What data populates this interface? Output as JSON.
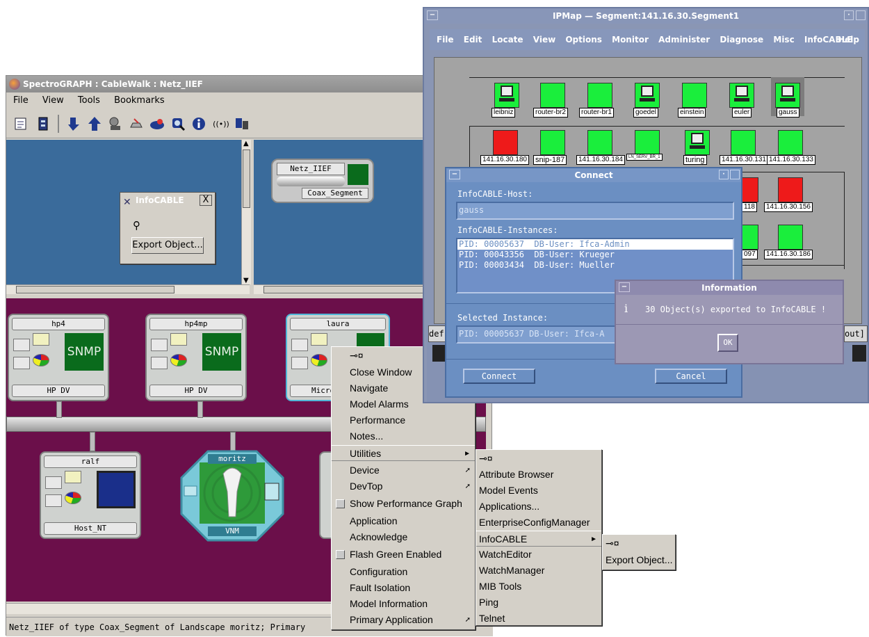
{
  "spectrograph": {
    "title": "SpectroGRAPH : CableWalk : Netz_IIEF",
    "menu": [
      "File",
      "View",
      "Tools",
      "Bookmarks"
    ],
    "toolbar_icons": [
      "notepad-icon",
      "archive-icon",
      "navigate-down-icon",
      "navigate-up-icon",
      "locate-icon",
      "alarm-icon",
      "network-icon",
      "search-icon",
      "info-icon",
      "broadcast-icon",
      "tools-icon"
    ],
    "infocable_window": {
      "title": "InfoCABLE",
      "close": "X",
      "export_button": "Export Object..."
    },
    "netz_object": {
      "name": "Netz_IIEF",
      "type": "Coax_Segment"
    },
    "devices": [
      {
        "name": "hp4",
        "type": "HP DV",
        "badge": "SNMP"
      },
      {
        "name": "hp4mp",
        "type": "HP DV",
        "badge": "SNMP"
      },
      {
        "name": "laura",
        "type": "Micro"
      },
      {
        "name": "ralf",
        "type": "Host_NT"
      },
      {
        "name": "moritz",
        "type": "VNM"
      }
    ],
    "status_text": "Netz_IIEF of type Coax_Segment of Landscape moritz; Primary"
  },
  "context_menu": {
    "items": [
      {
        "label": "Close Window"
      },
      {
        "label": "Navigate"
      },
      {
        "label": "Model Alarms"
      },
      {
        "label": "Performance"
      },
      {
        "label": "Notes..."
      },
      {
        "label": "Utilities",
        "submenu": true,
        "selected": true
      },
      {
        "label": "Device",
        "submenu": true
      },
      {
        "label": "DevTop",
        "submenu": true
      },
      {
        "label": "Show Performance Graph",
        "check": true
      },
      {
        "label": "Application"
      },
      {
        "label": "Acknowledge"
      },
      {
        "label": "Flash Green Enabled",
        "check": true
      },
      {
        "label": "Configuration"
      },
      {
        "label": "Fault Isolation"
      },
      {
        "label": "Model Information"
      },
      {
        "label": "Primary Application",
        "submenu": true
      }
    ]
  },
  "utilities_menu": {
    "items": [
      {
        "label": "Attribute Browser"
      },
      {
        "label": "Model Events"
      },
      {
        "label": "Applications..."
      },
      {
        "label": "EnterpriseConfigManager"
      },
      {
        "label": "InfoCABLE",
        "submenu": true,
        "selected": true
      },
      {
        "label": "WatchEditor"
      },
      {
        "label": "WatchManager"
      },
      {
        "label": "MIB Tools"
      },
      {
        "label": "Ping"
      },
      {
        "label": "Telnet"
      }
    ]
  },
  "infocable_menu": {
    "items": [
      {
        "label": "Export Object..."
      }
    ]
  },
  "ipmap": {
    "title": "IPMap — Segment:141.16.30.Segment1",
    "menu": [
      "File",
      "Edit",
      "Locate",
      "View",
      "Options",
      "Monitor",
      "Administer",
      "Diagnose",
      "Misc",
      "InfoCABLE",
      "Help"
    ],
    "row1": [
      {
        "label": "leibniz",
        "status": "green",
        "terminal": true
      },
      {
        "label": "router-br2",
        "status": "green"
      },
      {
        "label": "router-br1",
        "status": "green"
      },
      {
        "label": "goedel",
        "status": "green",
        "terminal": true
      },
      {
        "label": "einstein",
        "status": "green"
      },
      {
        "label": "euler",
        "status": "green",
        "terminal": true
      },
      {
        "label": "gauss",
        "status": "green",
        "terminal": true
      }
    ],
    "row2": [
      {
        "label": "141.16.30.180",
        "status": "red"
      },
      {
        "label": "snip-187",
        "status": "green"
      },
      {
        "label": "141.16.30.184",
        "status": "green"
      },
      {
        "label": "LN_SERV_BR_1",
        "status": "green"
      },
      {
        "label": "turing",
        "status": "terminal"
      },
      {
        "label": "141.16.30.131",
        "status": "green"
      },
      {
        "label": "141.16.30.133",
        "status": "green"
      }
    ],
    "row3": [
      {
        "label": "118",
        "status": "red"
      },
      {
        "label": "141.16.30.156",
        "status": "red"
      }
    ],
    "row4": [
      {
        "label": "097",
        "status": "green"
      },
      {
        "label": "141.16.30.186",
        "status": "green"
      }
    ],
    "bottom_left": "def",
    "bottom_right": "out]"
  },
  "connect_dialog": {
    "title": "Connect",
    "host_label": "InfoCABLE-Host:",
    "host_value": "gauss",
    "instances_label": "InfoCABLE-Instances:",
    "instances": [
      "PID: 00005637  DB-User: Ifca-Admin",
      "PID: 00043356  DB-User: Krueger",
      "PID: 00003434  DB-User: Mueller"
    ],
    "selected_label": "Selected Instance:",
    "selected_value": "PID: 00005637  DB-User: Ifca-A",
    "connect_button": "Connect",
    "cancel_button": "Cancel"
  },
  "info_dialog": {
    "title": "Information",
    "message": "30 Object(s) exported to InfoCABLE !",
    "ok_button": "OK"
  }
}
